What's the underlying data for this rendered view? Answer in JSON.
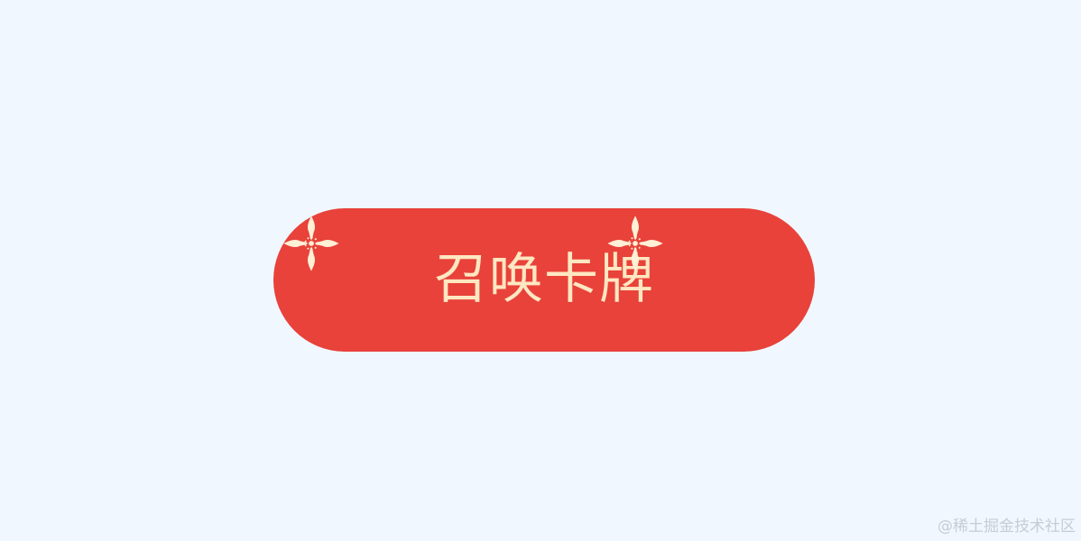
{
  "summon_button": {
    "label": "召唤卡牌"
  },
  "watermark": {
    "text": "@稀土掘金技术社区"
  },
  "icons": {
    "sparkle": "sparkle-icon"
  },
  "colors": {
    "page_background": "#f0f7ff",
    "button_background": "#e8423a",
    "button_text": "#ffe7c2",
    "sparkle": "#fff0d6",
    "watermark_text": "#c7ccd6"
  }
}
